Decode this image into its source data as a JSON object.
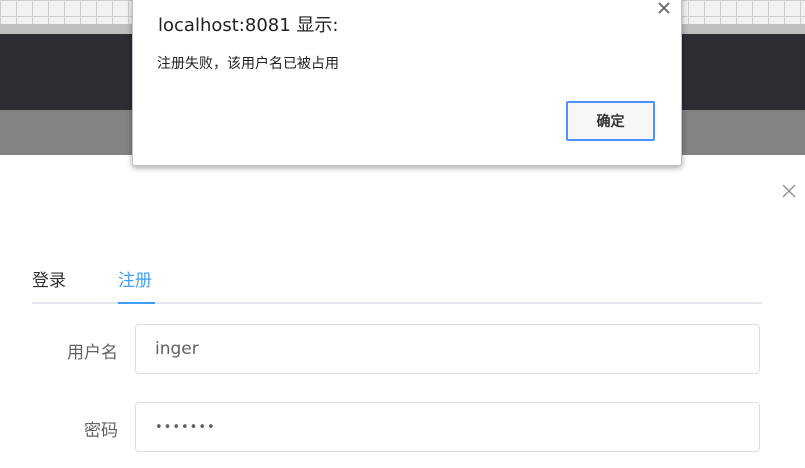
{
  "alert": {
    "title": "localhost:8081 显示:",
    "message": "注册失败，该用户名已被占用",
    "ok_label": "确定"
  },
  "auth_dialog": {
    "tabs": [
      {
        "label": "登录",
        "active": false
      },
      {
        "label": "注册",
        "active": true
      }
    ],
    "fields": {
      "username": {
        "label": "用户名",
        "value": "inger"
      },
      "password": {
        "label": "密码",
        "value": "•••••••"
      }
    }
  },
  "colors": {
    "accent": "#409eff",
    "alert_button_border": "#4d90fe",
    "header_dark": "#2f3136"
  },
  "icons": {
    "dialog_close": "close-icon",
    "alert_close": "close-icon"
  }
}
